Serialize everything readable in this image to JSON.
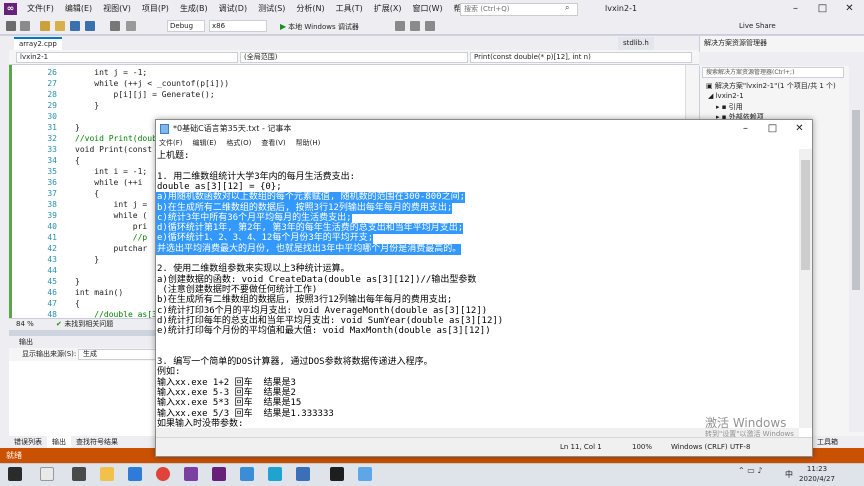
{
  "vs": {
    "menu": [
      "文件(F)",
      "编辑(E)",
      "视图(V)",
      "项目(P)",
      "生成(B)",
      "调试(D)",
      "测试(S)",
      "分析(N)",
      "工具(T)",
      "扩展(X)",
      "窗口(W)",
      "帮助(H)"
    ],
    "search_placeholder": "搜索 (Ctrl+Q)",
    "project_name": "lvxin2-1",
    "toolbar": {
      "config": "Debug",
      "platform": "x86",
      "run_label": "本地 Windows 调试器",
      "live_share": "Live Share"
    },
    "left_strip_label": "解决方案资源管理器  团队资源管理器  工具箱",
    "tabs": {
      "active": "array2.cpp",
      "other": "stdlib.h"
    },
    "nav": {
      "project": "lvxin2-1",
      "scope": "(全局范围)",
      "function": "Print(const double(* p)[12], int n)"
    },
    "code": [
      {
        "n": "26",
        "t": "    int j = -1;"
      },
      {
        "n": "27",
        "t": "    while (++j < _countof(p[i]))"
      },
      {
        "n": "28",
        "t": "        p[i][j] = Generate();"
      },
      {
        "n": "29",
        "t": "    }"
      },
      {
        "n": "30",
        "t": ""
      },
      {
        "n": "31",
        "t": "}"
      },
      {
        "n": "32",
        "t": "//void Print(double"
      },
      {
        "n": "33",
        "t": "void Print(const double"
      },
      {
        "n": "34",
        "t": "{"
      },
      {
        "n": "35",
        "t": "    int i = -1;"
      },
      {
        "n": "36",
        "t": "    while (++i"
      },
      {
        "n": "37",
        "t": "    {"
      },
      {
        "n": "38",
        "t": "        int j ="
      },
      {
        "n": "39",
        "t": "        while ("
      },
      {
        "n": "40",
        "t": "            pri"
      },
      {
        "n": "41",
        "t": "            //p"
      },
      {
        "n": "42",
        "t": "        putchar"
      },
      {
        "n": "43",
        "t": "    }"
      },
      {
        "n": "44",
        "t": ""
      },
      {
        "n": "45",
        "t": "}"
      },
      {
        "n": "46",
        "t": "int main()"
      },
      {
        "n": "47",
        "t": "{"
      },
      {
        "n": "48",
        "t": "    //double as[3]"
      }
    ],
    "zoom": "84 %",
    "no_issues": "未找到相关问题",
    "output_title": "输出",
    "output_src_label": "显示输出来源(S):",
    "output_src_value": "生成",
    "bottom_tabs": [
      "错误列表",
      "输出",
      "查找符号结果"
    ],
    "status": "就绪"
  },
  "solution": {
    "title": "解决方案资源管理器",
    "search": "搜索解决方案资源管理器(Ctrl+;)",
    "items": [
      "解决方案\"lvxin2-1\"(1 个项目/共 1 个)",
      "lvxin2-1",
      "引用",
      "外部依赖项"
    ],
    "bottom_tab": "工具箱"
  },
  "notepad": {
    "title": "*0基础C语言第35天.txt - 记事本",
    "menu": [
      "文件(F)",
      "编辑(E)",
      "格式(O)",
      "查看(V)",
      "帮助(H)"
    ],
    "lines": [
      {
        "t": "上机题:",
        "sel": false
      },
      {
        "t": "",
        "sel": false
      },
      {
        "t": "1. 用二维数组统计大学3年内的每月生活费支出:",
        "sel": false
      },
      {
        "t": "double as[3][12] = {0};",
        "sel": false
      },
      {
        "t": "a)用随机数函数对以上数组的每个元素赋值, 随机数的范围在300-800之间;",
        "sel": true
      },
      {
        "t": "b)在生成所有二维数组的数据后, 按照3行12列输出每年每月的费用支出;",
        "sel": true
      },
      {
        "t": "c)统计3年中所有36个月平均每月的生活费支出;",
        "sel": true
      },
      {
        "t": "d)循环统计第1年, 第2年, 第3年的每年生活费的总支出和当年平均月支出;",
        "sel": true
      },
      {
        "t": "e)循环统计1、2、3、4、12每个月份3年的平均开支;",
        "sel": true
      },
      {
        "t": "并选出平均消费最大的月份, 也就是找出3年中平均哪个月份是消费最高的。",
        "sel": true
      },
      {
        "t": "",
        "sel": false
      },
      {
        "t": "2. 使用二维数组参数来实现以上3种统计运算。",
        "sel": false
      },
      {
        "t": "a)创建数据的函数: void CreateData(double as[3][12])//输出型参数",
        "sel": false
      },
      {
        "t": " (注意创建数据时不要做任何统计工作)",
        "sel": false
      },
      {
        "t": "b)在生成所有二维数组的数据后, 按照3行12列输出每年每月的费用支出;",
        "sel": false
      },
      {
        "t": "c)统计打印36个月的平均月支出: void AverageMonth(double as[3][12])",
        "sel": false
      },
      {
        "t": "d)统计打印每年的总支出和当年平均月支出: void SumYear(double as[3][12])",
        "sel": false
      },
      {
        "t": "e)统计打印每个月份的平均值和最大值: void MaxMonth(double as[3][12])",
        "sel": false
      },
      {
        "t": "",
        "sel": false
      },
      {
        "t": "",
        "sel": false
      },
      {
        "t": "3. 编写一个简单的DOS计算器, 通过DOS参数将数据传递进入程序。",
        "sel": false
      },
      {
        "t": "例如:",
        "sel": false
      },
      {
        "t": "输入xx.exe 1+2 回车  结果是3",
        "sel": false
      },
      {
        "t": "输入xx.exe 5-3 回车  结果是2",
        "sel": false
      },
      {
        "t": "输入xx.exe 5*3 回车  结果是15",
        "sel": false
      },
      {
        "t": "输入xx.exe 5/3 回车  结果是1.333333",
        "sel": false
      },
      {
        "t": "如果输入时没带参数:",
        "sel": false
      }
    ],
    "status": {
      "position": "Ln 11, Col 1",
      "zoom": "100%",
      "eol": "Windows (CRLF)",
      "encoding": "UTF-8"
    }
  },
  "watermark": {
    "line1": "激活 Windows",
    "line2": "转到\"设置\"以激活 Windows"
  },
  "taskbar": {
    "time": "11:23",
    "date": "2020/4/27",
    "ime": "中"
  }
}
